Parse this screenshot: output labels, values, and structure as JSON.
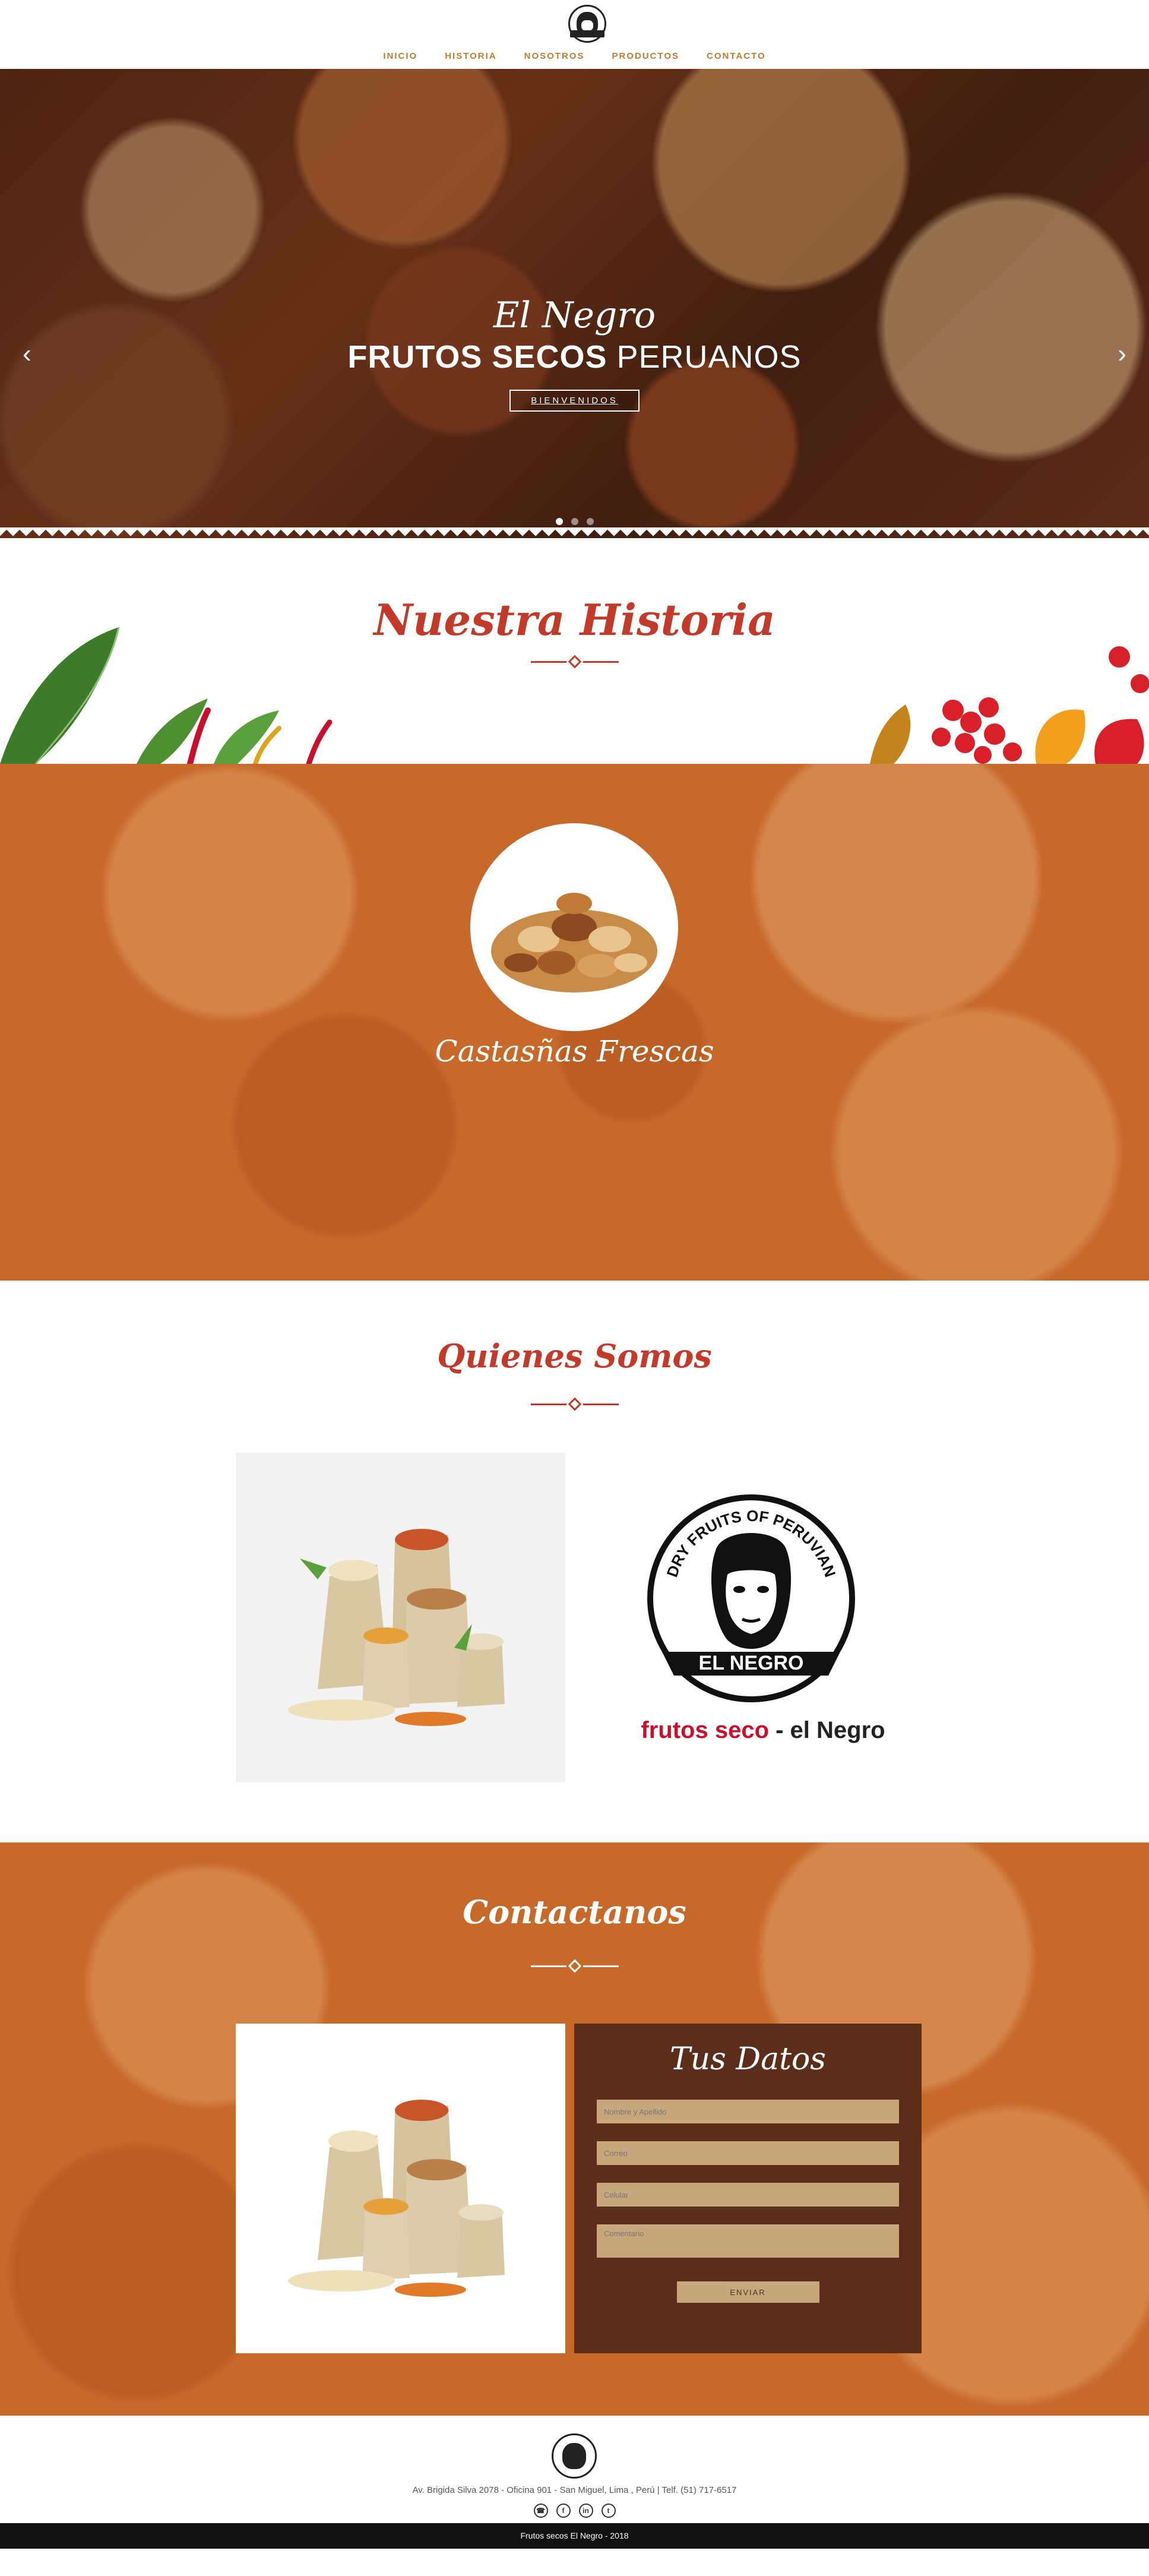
{
  "nav": {
    "items": [
      "INICIO",
      "HISTORIA",
      "NOSOTROS",
      "PRODUCTOS",
      "CONTACTO"
    ]
  },
  "hero": {
    "script_title": "El Negro",
    "title_bold": "FRUTOS SECOS",
    "title_light": "PERUANOS",
    "button": "BIENVENIDOS",
    "slides_total": 3,
    "active_slide": 1
  },
  "historia": {
    "title": "Nuestra Historia",
    "caption": "Castasñas Frescas"
  },
  "quienes": {
    "title": "Quienes Somos",
    "logo_text_top": "DRY FRUITS OF PERUVIAN",
    "logo_ribbon": "EL NEGRO",
    "brand_red": "frutos seco",
    "brand_sep": " - ",
    "brand_dark": "el Negro"
  },
  "contact": {
    "title": "Contactanos",
    "form_title": "Tus Datos",
    "fields": {
      "name_placeholder": "Nombre y Apellido",
      "email_placeholder": "Correo",
      "phone_placeholder": "Celular",
      "comment_placeholder": "Comentario"
    },
    "send": "ENVIAR"
  },
  "footer": {
    "address": "Av. Brigida Silva 2078 - Oficina 901 - San Miguel, Lima , Perú | Telf. (51) 717-6517",
    "socials": [
      "whatsapp-icon",
      "facebook-icon",
      "linkedin-icon",
      "twitter-icon"
    ],
    "copyright": "Frutos secos El Negro - 2018"
  },
  "colors": {
    "accent_red": "#c13a2a",
    "nav_orange": "#c6792e",
    "band_orange": "#c7692a",
    "form_brown": "#5a2e1a",
    "input_tan": "#c8a77d"
  }
}
